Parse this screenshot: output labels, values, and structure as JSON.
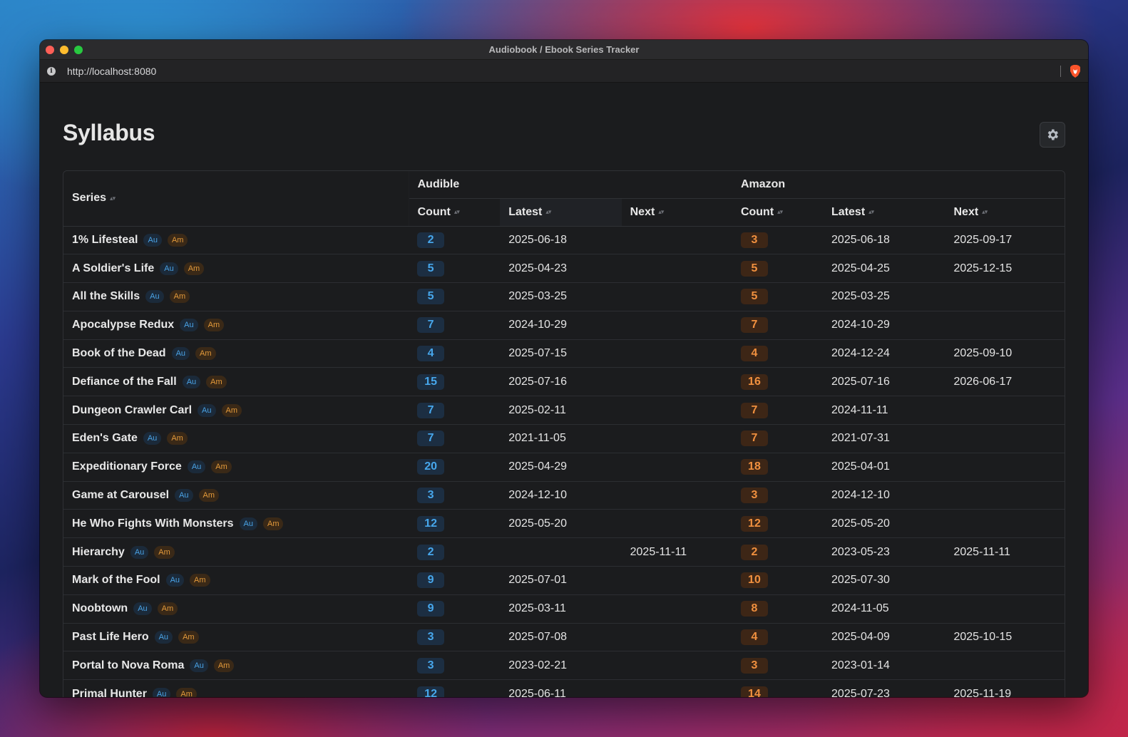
{
  "window": {
    "title": "Audiobook / Ebook Series Tracker"
  },
  "urlbar": {
    "url": "http://localhost:8080"
  },
  "page": {
    "title": "Syllabus"
  },
  "table": {
    "groups": {
      "audible": "Audible",
      "amazon": "Amazon"
    },
    "columns": {
      "series": "Series",
      "au_count": "Count",
      "au_latest": "Latest",
      "au_next": "Next",
      "am_count": "Count",
      "am_latest": "Latest",
      "am_next": "Next"
    },
    "sort_glyph": "▴▾",
    "tags": {
      "au": "Au",
      "am": "Am"
    },
    "rows": [
      {
        "series": "1% Lifesteal",
        "au_count": "2",
        "au_latest": "2025-06-18",
        "au_next": "",
        "am_count": "3",
        "am_latest": "2025-06-18",
        "am_next": "2025-09-17"
      },
      {
        "series": "A Soldier's Life",
        "au_count": "5",
        "au_latest": "2025-04-23",
        "au_next": "",
        "am_count": "5",
        "am_latest": "2025-04-25",
        "am_next": "2025-12-15"
      },
      {
        "series": "All the Skills",
        "au_count": "5",
        "au_latest": "2025-03-25",
        "au_next": "",
        "am_count": "5",
        "am_latest": "2025-03-25",
        "am_next": ""
      },
      {
        "series": "Apocalypse Redux",
        "au_count": "7",
        "au_latest": "2024-10-29",
        "au_next": "",
        "am_count": "7",
        "am_latest": "2024-10-29",
        "am_next": ""
      },
      {
        "series": "Book of the Dead",
        "au_count": "4",
        "au_latest": "2025-07-15",
        "au_next": "",
        "am_count": "4",
        "am_latest": "2024-12-24",
        "am_next": "2025-09-10"
      },
      {
        "series": "Defiance of the Fall",
        "au_count": "15",
        "au_latest": "2025-07-16",
        "au_next": "",
        "am_count": "16",
        "am_latest": "2025-07-16",
        "am_next": "2026-06-17"
      },
      {
        "series": "Dungeon Crawler Carl",
        "au_count": "7",
        "au_latest": "2025-02-11",
        "au_next": "",
        "am_count": "7",
        "am_latest": "2024-11-11",
        "am_next": ""
      },
      {
        "series": "Eden's Gate",
        "au_count": "7",
        "au_latest": "2021-11-05",
        "au_next": "",
        "am_count": "7",
        "am_latest": "2021-07-31",
        "am_next": ""
      },
      {
        "series": "Expeditionary Force",
        "au_count": "20",
        "au_latest": "2025-04-29",
        "au_next": "",
        "am_count": "18",
        "am_latest": "2025-04-01",
        "am_next": ""
      },
      {
        "series": "Game at Carousel",
        "au_count": "3",
        "au_latest": "2024-12-10",
        "au_next": "",
        "am_count": "3",
        "am_latest": "2024-12-10",
        "am_next": ""
      },
      {
        "series": "He Who Fights With Monsters",
        "au_count": "12",
        "au_latest": "2025-05-20",
        "au_next": "",
        "am_count": "12",
        "am_latest": "2025-05-20",
        "am_next": ""
      },
      {
        "series": "Hierarchy",
        "au_count": "2",
        "au_latest": "",
        "au_next": "2025-11-11",
        "am_count": "2",
        "am_latest": "2023-05-23",
        "am_next": "2025-11-11"
      },
      {
        "series": "Mark of the Fool",
        "au_count": "9",
        "au_latest": "2025-07-01",
        "au_next": "",
        "am_count": "10",
        "am_latest": "2025-07-30",
        "am_next": ""
      },
      {
        "series": "Noobtown",
        "au_count": "9",
        "au_latest": "2025-03-11",
        "au_next": "",
        "am_count": "8",
        "am_latest": "2024-11-05",
        "am_next": ""
      },
      {
        "series": "Past Life Hero",
        "au_count": "3",
        "au_latest": "2025-07-08",
        "au_next": "",
        "am_count": "4",
        "am_latest": "2025-04-09",
        "am_next": "2025-10-15"
      },
      {
        "series": "Portal to Nova Roma",
        "au_count": "3",
        "au_latest": "2023-02-21",
        "au_next": "",
        "am_count": "3",
        "am_latest": "2023-01-14",
        "am_next": ""
      },
      {
        "series": "Primal Hunter",
        "au_count": "12",
        "au_latest": "2025-06-11",
        "au_next": "",
        "am_count": "14",
        "am_latest": "2025-07-23",
        "am_next": "2025-11-19"
      }
    ]
  },
  "colors": {
    "audible_accent": "#47a7ec",
    "amazon_accent": "#f0903f",
    "background": "#1b1c1e"
  },
  "icons": {
    "settings": "gear-icon",
    "site_info": "info-icon",
    "browser": "brave-lion-icon"
  }
}
